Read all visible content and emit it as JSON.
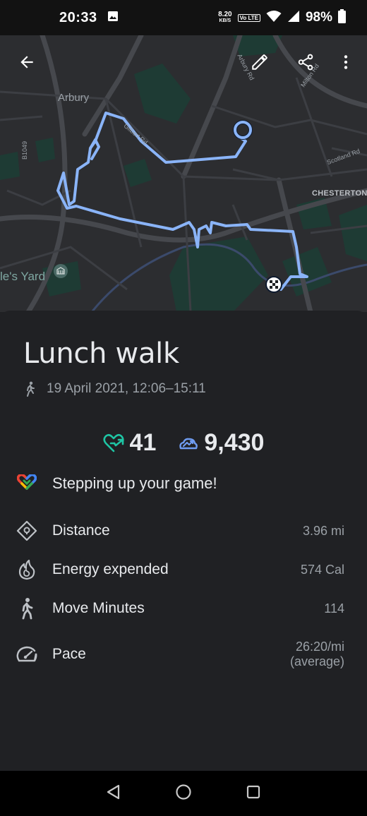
{
  "status_bar": {
    "time": "20:33",
    "net_speed_value": "8.20",
    "net_speed_unit": "KB/S",
    "volte": "Vo LTE",
    "battery": "98%"
  },
  "map": {
    "labels": {
      "arbury": "Arbury",
      "arbury_rd": "Arbury Rd",
      "milton_rd": "Milton Rd",
      "gilbert_rd": "Gilbert Rd",
      "scotland_rd": "Scotland Rd",
      "chesterton": "CHESTERTON",
      "road_b1049": "B1049",
      "yard": "le's Yard"
    },
    "colors": {
      "route": "#8ab4f8",
      "background": "#2c2d30",
      "park": "#1e3b34"
    }
  },
  "activity": {
    "title": "Lunch walk",
    "date_range": "19 April 2021, 12:06–15:11",
    "heart_points": "41",
    "steps": "9,430",
    "insight": "Stepping up your game!",
    "stats": [
      {
        "icon": "distance-icon",
        "label": "Distance",
        "value": "3.96 mi"
      },
      {
        "icon": "flame-icon",
        "label": "Energy expended",
        "value": "574 Cal"
      },
      {
        "icon": "walking-icon",
        "label": "Move Minutes",
        "value": "114"
      },
      {
        "icon": "speedometer-icon",
        "label": "Pace",
        "value_line1": "26:20/mi",
        "value_line2": "(average)"
      }
    ]
  },
  "colors": {
    "heart_points": "#1ec5a4",
    "steps": "#6f9cf1",
    "accent_blue": "#8ab4f8"
  }
}
